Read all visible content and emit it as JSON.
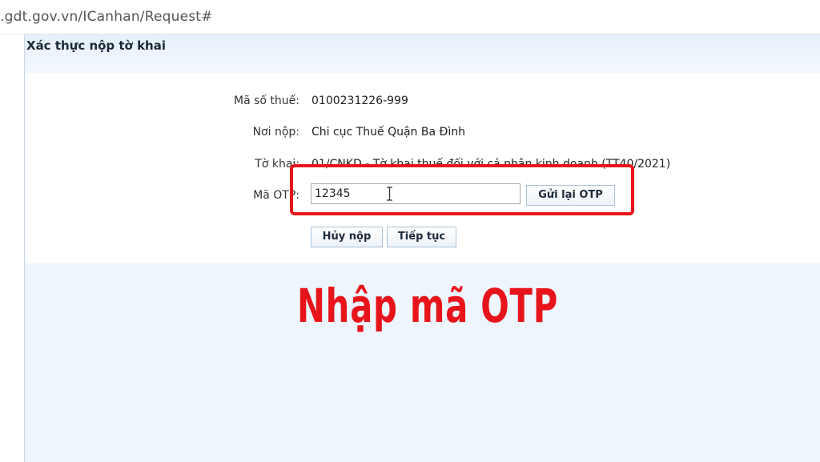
{
  "browser": {
    "url": ".gdt.gov.vn/ICanhan/Request#"
  },
  "panel": {
    "title": "Xác thực nộp tờ khai"
  },
  "form": {
    "rows": [
      {
        "label": "Mã số thuế:",
        "value": "0100231226-999"
      },
      {
        "label": "Nơi nộp:",
        "value": "Chi cục Thuế Quận Ba Đình"
      },
      {
        "label": "Tờ khai:",
        "value": "01/CNKD - Tờ khai thuế đối với cá nhân kinh doanh (TT40/2021)"
      }
    ],
    "otp": {
      "label": "Mã OTP:",
      "value": "12345",
      "resend_label": "Gửi lại OTP"
    },
    "cancel_label": "Hủy nộp",
    "continue_label": "Tiếp tục"
  },
  "overlay": {
    "caption": "Nhập mã OTP",
    "color": "#e8141c"
  }
}
